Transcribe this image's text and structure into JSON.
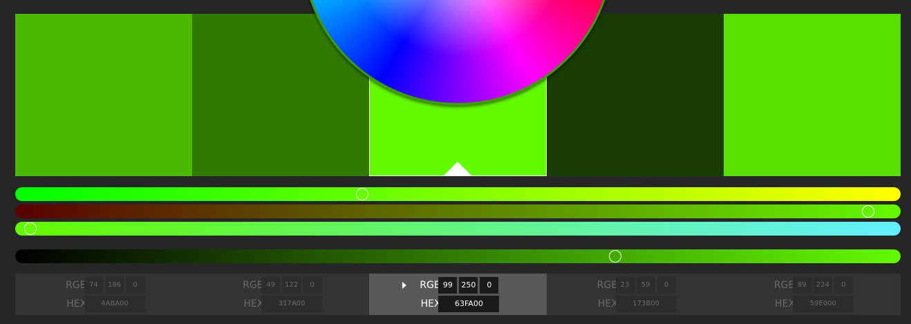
{
  "swatches": [
    {
      "color": "#4ABA00",
      "active": false
    },
    {
      "color": "#317A00",
      "active": false
    },
    {
      "color": "#63FA00",
      "active": true
    },
    {
      "color": "#173B00",
      "active": false
    },
    {
      "color": "#59E000",
      "active": false
    }
  ],
  "wheel": {
    "ring_color": "#3C9E00"
  },
  "sliders": [
    {
      "name": "hue-slider",
      "gradient": [
        "#00FF00",
        "#FFFF00"
      ],
      "value": 0.39
    },
    {
      "name": "saturation-slider",
      "gradient": [
        "#5A0000",
        "#63FA00"
      ],
      "value": 0.97
    },
    {
      "name": "tint-slider",
      "gradient": [
        "#63FA00",
        "#63F0FF"
      ],
      "value": 0.01
    },
    {
      "name": "brightness-slider",
      "gradient": [
        "#000000",
        "#63FA00"
      ],
      "value": 0.68
    }
  ],
  "labels": {
    "rgb": "RGB",
    "hex": "HEX"
  },
  "panels": [
    {
      "r": "74",
      "g": "186",
      "b": "0",
      "hex": "4ABA00",
      "active": false
    },
    {
      "r": "49",
      "g": "122",
      "b": "0",
      "hex": "317A00",
      "active": false
    },
    {
      "r": "99",
      "g": "250",
      "b": "0",
      "hex": "63FA00",
      "active": true
    },
    {
      "r": "23",
      "g": "59",
      "b": "0",
      "hex": "173B00",
      "active": false
    },
    {
      "r": "89",
      "g": "224",
      "b": "0",
      "hex": "59E000",
      "active": false
    }
  ],
  "icons": {
    "active_marker": "triangle-up-icon",
    "active_caret": "caret-right-icon"
  }
}
